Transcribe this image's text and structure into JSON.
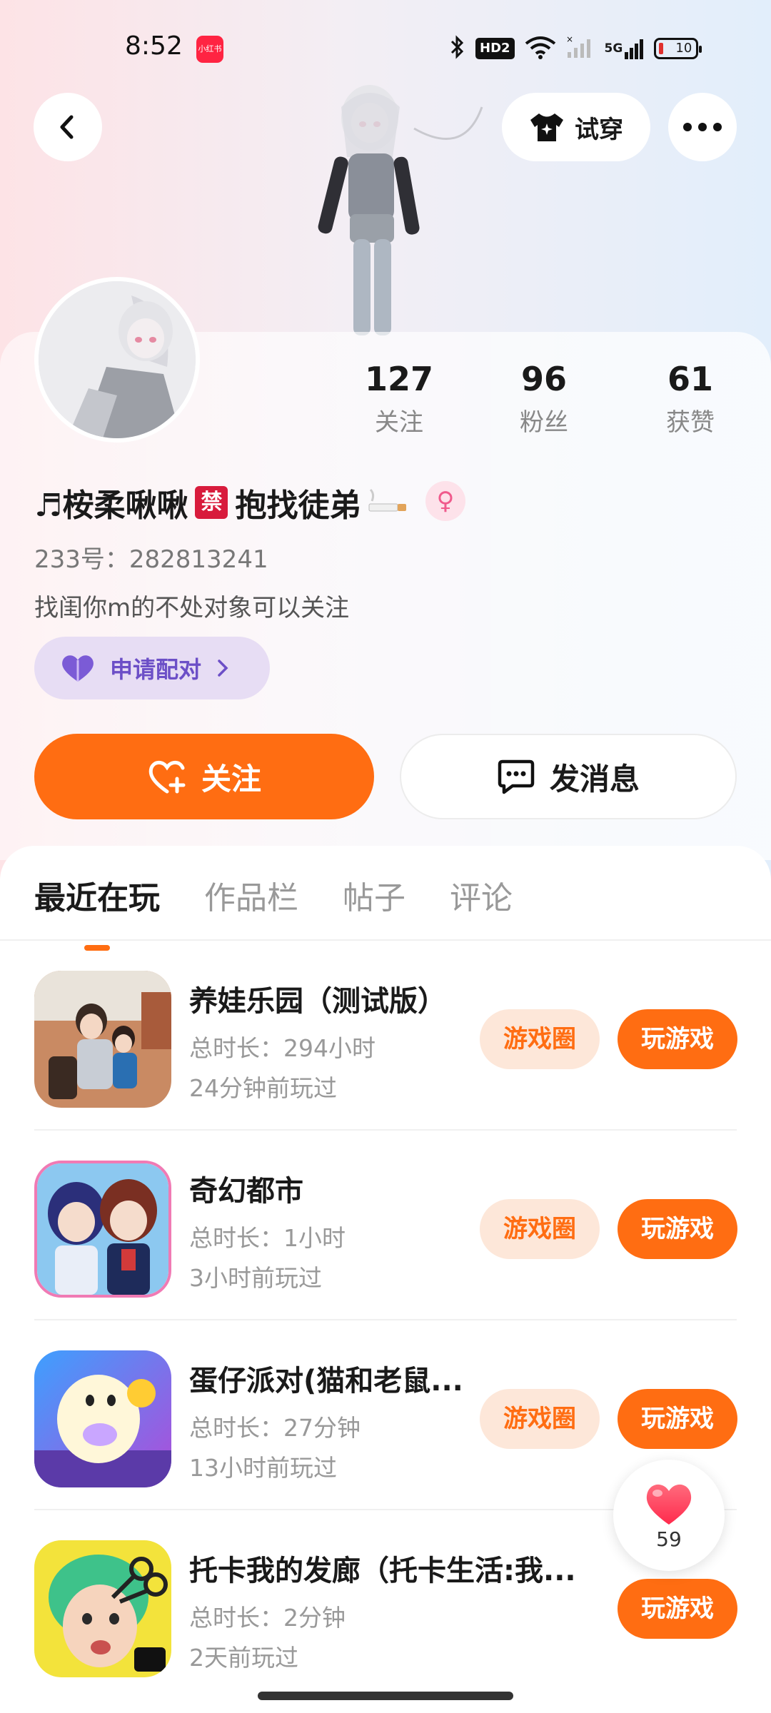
{
  "status_bar": {
    "time": "8:52",
    "notification_app": "小红书",
    "hd_label": "HD2",
    "network_label": "5G",
    "battery": "10"
  },
  "header": {
    "tryon_label": "试穿"
  },
  "profile": {
    "stats": [
      {
        "value": "127",
        "label": "关注"
      },
      {
        "value": "96",
        "label": "粉丝"
      },
      {
        "value": "61",
        "label": "获赞"
      }
    ],
    "name_part1": "♬桉柔啾啾",
    "name_ban_emoji": "禁",
    "name_part2": "抱找徒弟",
    "gender_symbol": "♀",
    "uid": "233号：282813241",
    "bio": "找闺你m的不处对象可以关注",
    "match_label": "申请配对",
    "follow_label": "关注",
    "message_label": "发消息"
  },
  "tabs": [
    {
      "label": "最近在玩",
      "active": true
    },
    {
      "label": "作品栏",
      "active": false
    },
    {
      "label": "帖子",
      "active": false
    },
    {
      "label": "评论",
      "active": false
    }
  ],
  "games": [
    {
      "title": "养娃乐园（测试版）",
      "duration": "总时长：294小时",
      "last_played": "24分钟前玩过",
      "circle_label": "游戏圈",
      "play_label": "玩游戏"
    },
    {
      "title": "奇幻都市",
      "duration": "总时长：1小时",
      "last_played": "3小时前玩过",
      "circle_label": "游戏圈",
      "play_label": "玩游戏"
    },
    {
      "title": "蛋仔派对(猫和老鼠...",
      "duration": "总时长：27分钟",
      "last_played": "13小时前玩过",
      "circle_label": "游戏圈",
      "play_label": "玩游戏"
    },
    {
      "title": "托卡我的发廊（托卡生活:我...",
      "duration": "总时长：2分钟",
      "last_played": "2天前玩过",
      "play_label": "玩游戏"
    }
  ],
  "like_fab": {
    "count": "59"
  },
  "colors": {
    "accent": "#ff6d12",
    "accent_soft": "#fde7d9",
    "match_purple": "#6c4fc7"
  }
}
